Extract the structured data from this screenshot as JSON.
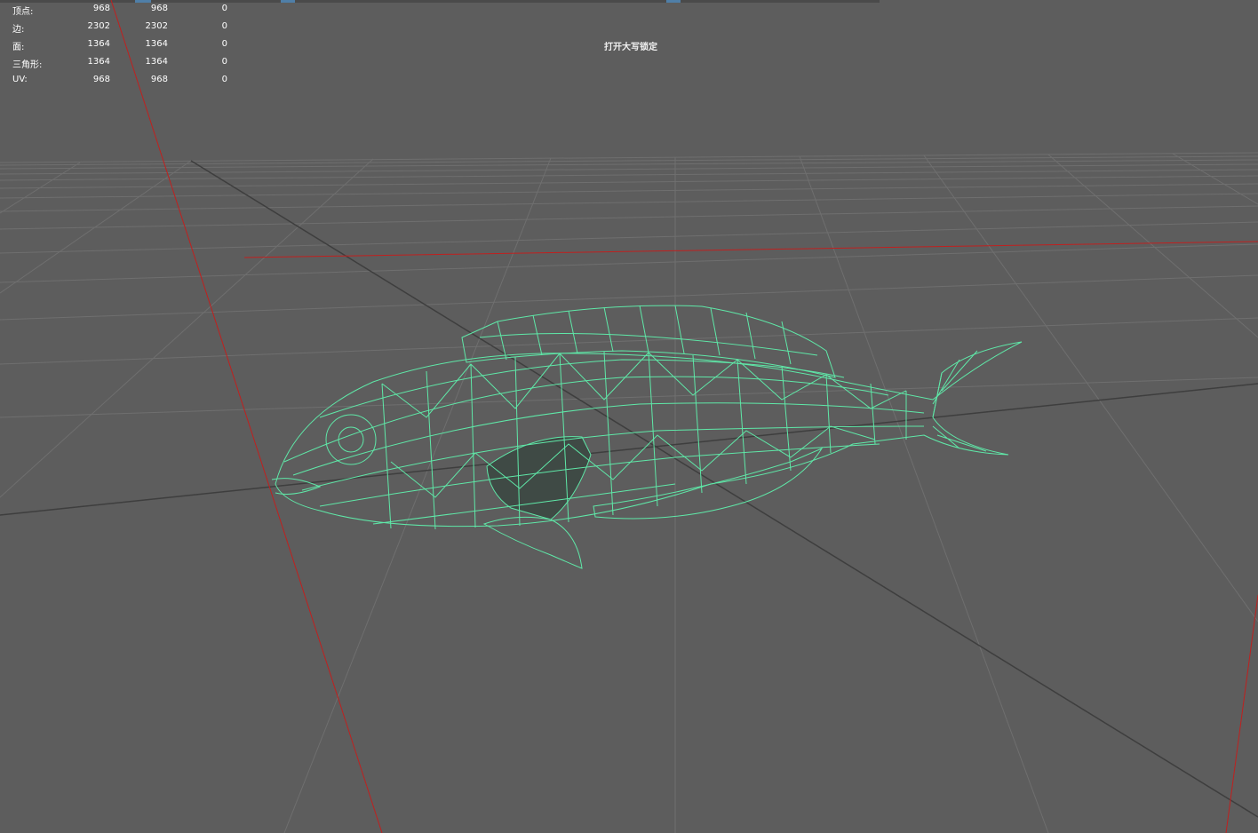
{
  "hud": {
    "rows": [
      {
        "label": "顶点:",
        "c1": "968",
        "c2": "968",
        "c3": "0"
      },
      {
        "label": "边:",
        "c1": "2302",
        "c2": "2302",
        "c3": "0"
      },
      {
        "label": "面:",
        "c1": "1364",
        "c2": "1364",
        "c3": "0"
      },
      {
        "label": "三角形:",
        "c1": "1364",
        "c2": "1364",
        "c3": "0"
      },
      {
        "label": "UV:",
        "c1": "968",
        "c2": "968",
        "c3": "0"
      }
    ]
  },
  "viewport": {
    "message": "打开大写锁定",
    "background": "#5d5d5d",
    "grid_color": "#6e6e6e",
    "axis_color": "#c0201f",
    "wireframe_color": "#5fe8a8"
  }
}
